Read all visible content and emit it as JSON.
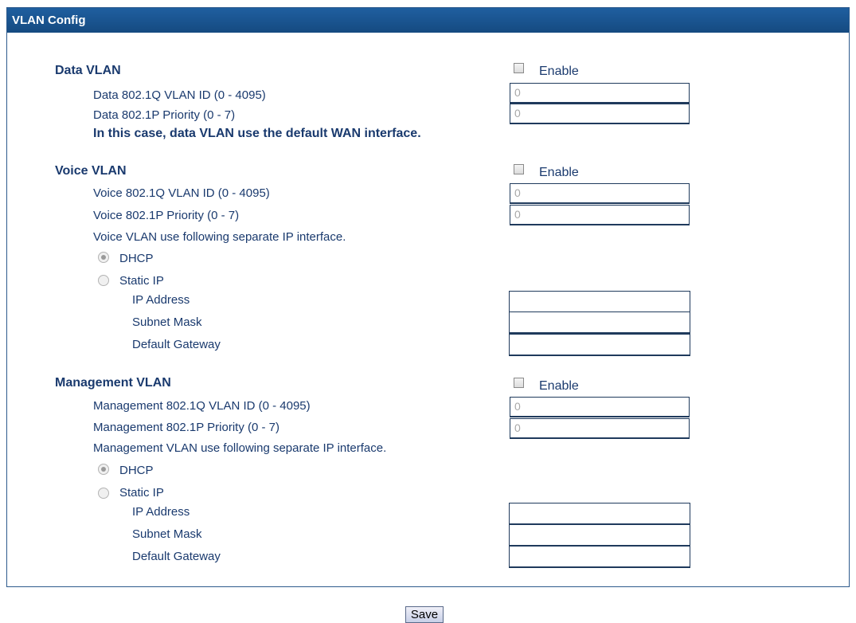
{
  "panel": {
    "title": "VLAN Config"
  },
  "data_vlan": {
    "title": "Data VLAN",
    "enable_label": "Enable",
    "vlan_id_label": "Data 802.1Q VLAN ID (0 - 4095)",
    "vlan_id_value": "0",
    "priority_label": "Data 802.1P Priority (0 - 7)",
    "priority_value": "0",
    "note": "In this case, data VLAN use the default WAN interface."
  },
  "voice_vlan": {
    "title": "Voice VLAN",
    "enable_label": "Enable",
    "vlan_id_label": "Voice 802.1Q VLAN ID (0 - 4095)",
    "vlan_id_value": "0",
    "priority_label": "Voice 802.1P Priority (0 - 7)",
    "priority_value": "0",
    "note": "Voice VLAN use following separate IP interface.",
    "dhcp_label": "DHCP",
    "static_label": "Static IP",
    "ip_label": "IP Address",
    "mask_label": "Subnet Mask",
    "gateway_label": "Default Gateway"
  },
  "mgmt_vlan": {
    "title": "Management VLAN",
    "enable_label": "Enable",
    "vlan_id_label": "Management 802.1Q VLAN ID (0 - 4095)",
    "vlan_id_value": "0",
    "priority_label": "Management 802.1P Priority (0 - 7)",
    "priority_value": "0",
    "note": "Management VLAN use following separate IP interface.",
    "dhcp_label": "DHCP",
    "static_label": "Static IP",
    "ip_label": "IP Address",
    "mask_label": "Subnet Mask",
    "gateway_label": "Default Gateway"
  },
  "save_label": "Save"
}
